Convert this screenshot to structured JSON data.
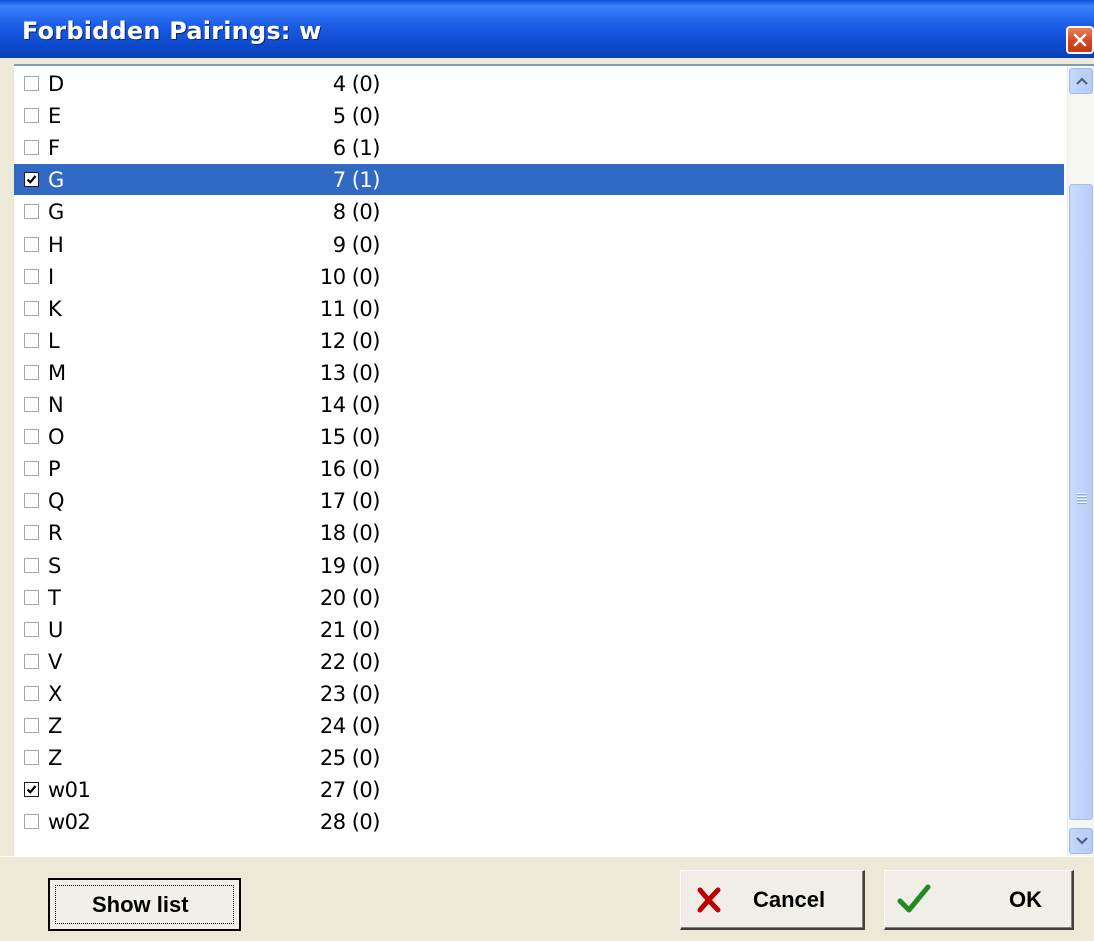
{
  "window": {
    "title": "Forbidden Pairings: w"
  },
  "list": {
    "items": [
      {
        "name": "D",
        "number": "4 (0)",
        "checked": false,
        "selected": false
      },
      {
        "name": "E",
        "number": "5 (0)",
        "checked": false,
        "selected": false
      },
      {
        "name": "F",
        "number": "6 (1)",
        "checked": false,
        "selected": false
      },
      {
        "name": "G",
        "number": "7 (1)",
        "checked": true,
        "selected": true
      },
      {
        "name": "G",
        "number": "8 (0)",
        "checked": false,
        "selected": false
      },
      {
        "name": "H",
        "number": "9 (0)",
        "checked": false,
        "selected": false
      },
      {
        "name": "I",
        "number": "10 (0)",
        "checked": false,
        "selected": false
      },
      {
        "name": "K",
        "number": "11 (0)",
        "checked": false,
        "selected": false
      },
      {
        "name": "L",
        "number": "12 (0)",
        "checked": false,
        "selected": false
      },
      {
        "name": "M",
        "number": "13 (0)",
        "checked": false,
        "selected": false
      },
      {
        "name": "N",
        "number": "14 (0)",
        "checked": false,
        "selected": false
      },
      {
        "name": "O",
        "number": "15 (0)",
        "checked": false,
        "selected": false
      },
      {
        "name": "P",
        "number": "16 (0)",
        "checked": false,
        "selected": false
      },
      {
        "name": "Q",
        "number": "17 (0)",
        "checked": false,
        "selected": false
      },
      {
        "name": "R",
        "number": "18 (0)",
        "checked": false,
        "selected": false
      },
      {
        "name": "S",
        "number": "19 (0)",
        "checked": false,
        "selected": false
      },
      {
        "name": "T",
        "number": "20 (0)",
        "checked": false,
        "selected": false
      },
      {
        "name": "U",
        "number": "21 (0)",
        "checked": false,
        "selected": false
      },
      {
        "name": "V",
        "number": "22 (0)",
        "checked": false,
        "selected": false
      },
      {
        "name": "X",
        "number": "23 (0)",
        "checked": false,
        "selected": false
      },
      {
        "name": "Z",
        "number": "24 (0)",
        "checked": false,
        "selected": false
      },
      {
        "name": "Z",
        "number": "25 (0)",
        "checked": false,
        "selected": false
      },
      {
        "name": "w01",
        "number": "27 (0)",
        "checked": true,
        "selected": false
      },
      {
        "name": "w02",
        "number": "28 (0)",
        "checked": false,
        "selected": false
      }
    ]
  },
  "buttons": {
    "show_list": "Show list",
    "cancel": "Cancel",
    "ok": "OK"
  },
  "icons": {
    "close": "close-icon",
    "cancel": "red-x-icon",
    "ok": "green-check-icon",
    "scroll_up": "chevron-up-icon",
    "scroll_down": "chevron-down-icon"
  },
  "colors": {
    "title_bar": "#0a47c8",
    "selection": "#316ac5",
    "cancel_icon": "#c00000",
    "ok_icon": "#1f8a1f"
  }
}
